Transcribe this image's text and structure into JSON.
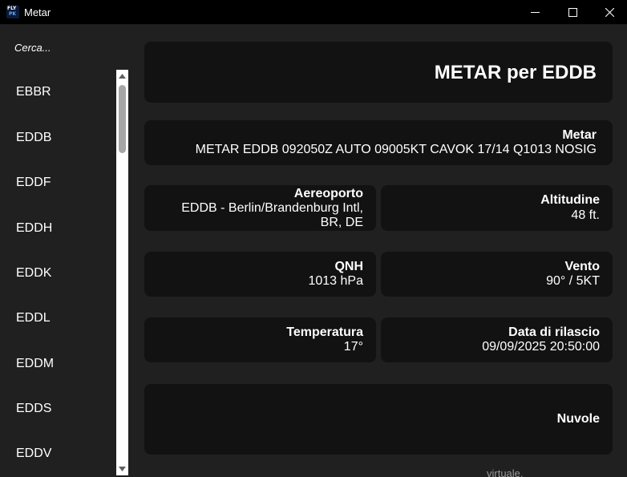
{
  "window": {
    "title": "Metar",
    "icon_top": "FLY",
    "icon_bottom": "PK"
  },
  "sidebar": {
    "search_placeholder": "Cerca...",
    "items": [
      "EBBR",
      "EDDB",
      "EDDF",
      "EDDH",
      "EDDK",
      "EDDL",
      "EDDM",
      "EDDS",
      "EDDV"
    ]
  },
  "main": {
    "heading": "METAR per EDDB",
    "metar": {
      "label": "Metar",
      "value": "METAR EDDB 092050Z AUTO 09005KT CAVOK 17/14 Q1013 NOSIG"
    },
    "airport": {
      "label": "Aereoporto",
      "line1": "EDDB - Berlin/Brandenburg Intl,",
      "line2": "BR, DE"
    },
    "altitude": {
      "label": "Altitudine",
      "value": "48 ft."
    },
    "qnh": {
      "label": "QNH",
      "value": "1013 hPa"
    },
    "wind": {
      "label": "Vento",
      "value": "90° / 5KT"
    },
    "temperature": {
      "label": "Temperatura",
      "value": "17°"
    },
    "issued": {
      "label": "Data di rilascio",
      "value": "09/09/2025 20:50:00"
    },
    "clouds": {
      "label": "Nuvole"
    }
  },
  "background_window": {
    "text": "virtuale."
  },
  "colors": {
    "window_bg": "#202020",
    "card_bg": "#121212",
    "titlebar_bg": "#000000",
    "scrollbar_track": "#ffffff",
    "scrollbar_thumb": "#a6a6a6",
    "text": "#ffffff"
  }
}
